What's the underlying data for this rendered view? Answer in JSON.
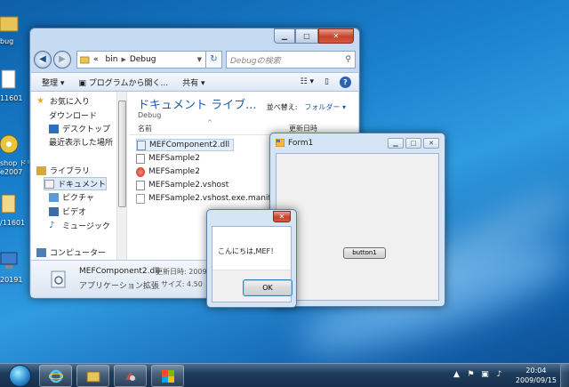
{
  "desktop": {
    "icons": [
      {
        "label": "bug",
        "icon": "folder-icon"
      },
      {
        "label": "11601",
        "icon": "document-icon"
      },
      {
        "label": "shop ドリ",
        "label2": "e2007",
        "icon": "disc-icon"
      },
      {
        "label": "/11601",
        "icon": "document-icon"
      },
      {
        "label": "20191",
        "icon": "computer-icon"
      }
    ]
  },
  "explorer": {
    "address": {
      "prefix": "«",
      "crumbs": [
        "bin",
        "Debug"
      ]
    },
    "search_placeholder": "Debugの検索",
    "toolbar": {
      "organize": "整理 ▾",
      "open_with": "プログラムから開く...",
      "share": "共有 ▾",
      "view": "☷ ▾"
    },
    "nav": {
      "favorites": "お気に入り",
      "downloads": "ダウンロード",
      "desktop": "デスクトップ",
      "recent": "最近表示した場所",
      "libraries": "ライブラリ",
      "documents": "ドキュメント",
      "pictures": "ピクチャ",
      "videos": "ビデオ",
      "music": "ミュージック",
      "computer": "コンピューター"
    },
    "library_title": "ドキュメント ライブ...",
    "library_sub": "Debug",
    "arrange_label": "並べ替え:",
    "arrange_value": "フォルダー ▾",
    "columns": {
      "name": "名前",
      "modified": "更新日時"
    },
    "files": [
      {
        "name": "MEFComponent2.dll",
        "icon": "dll-icon",
        "selected": true
      },
      {
        "name": "MEFSample2",
        "icon": "config-icon",
        "selected": false
      },
      {
        "name": "MEFSample2",
        "icon": "exe-icon",
        "selected": false
      },
      {
        "name": "MEFSample2.vshost",
        "icon": "config-icon",
        "selected": false
      },
      {
        "name": "MEFSample2.vshost.exe.manifest",
        "icon": "file-icon",
        "selected": false
      }
    ],
    "details": {
      "name": "MEFComponent2.dll",
      "type": "アプリケーション拡張",
      "modified_label": "更新日時: 2009",
      "size_label": "サイズ: 4.50"
    }
  },
  "form1": {
    "title": "Form1",
    "button_label": "button1"
  },
  "msgbox": {
    "text": "こんにちは,MEF！",
    "ok_label": "OK",
    "close_glyph": "✕"
  },
  "window_buttons": {
    "minimize": "▁",
    "maximize": "□",
    "close": "✕"
  },
  "taskbar": {
    "clock_time": "20:04",
    "clock_date": "2009/09/15",
    "apps": [
      {
        "icon": "internet-explorer-icon"
      },
      {
        "icon": "windows-explorer-icon"
      },
      {
        "icon": "visual-studio-icon"
      },
      {
        "icon": "form-app-icon"
      }
    ]
  },
  "colors": {
    "accent": "#1e5aa8",
    "close_red": "#c7422c"
  }
}
